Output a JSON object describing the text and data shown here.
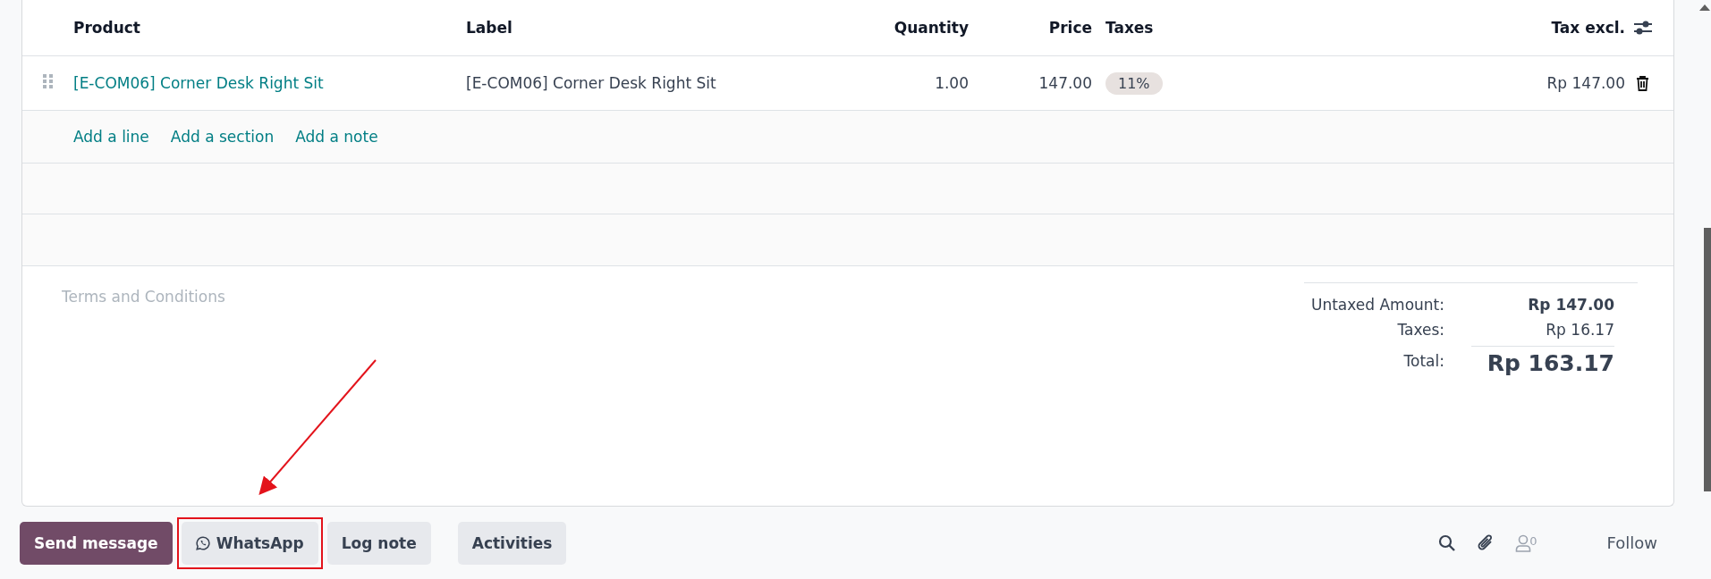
{
  "table": {
    "columns": [
      {
        "label": "Product"
      },
      {
        "label": "Label"
      },
      {
        "label": "Quantity"
      },
      {
        "label": "Price"
      },
      {
        "label": "Taxes"
      },
      {
        "label": "Tax excl."
      }
    ],
    "rows": [
      {
        "product": "[E-COM06] Corner Desk Right Sit",
        "label": "[E-COM06] Corner Desk Right Sit",
        "quantity": "1.00",
        "price": "147.00",
        "taxes": [
          "11%"
        ],
        "subtotal": "Rp 147.00"
      }
    ],
    "add_actions": [
      "Add a line",
      "Add a section",
      "Add a note"
    ]
  },
  "terms": {
    "placeholder": "Terms and Conditions"
  },
  "totals": [
    {
      "label": "Untaxed Amount:",
      "value": "Rp 147.00",
      "kind": "subtotal"
    },
    {
      "label": "Taxes:",
      "value": "Rp 16.17",
      "kind": "tax"
    },
    {
      "label": "Total:",
      "value": "Rp 163.17",
      "kind": "total"
    }
  ],
  "chatter": {
    "buttons": [
      {
        "label": "Send message",
        "kind": "primary",
        "highlighted": false
      },
      {
        "label": "WhatsApp",
        "kind": "whatsapp",
        "highlighted": true
      },
      {
        "label": "Log note",
        "kind": "secondary",
        "highlighted": false
      },
      {
        "label": "Activities",
        "kind": "secondary",
        "highlighted": false
      }
    ],
    "follower_count": "0",
    "follow": "Follow"
  }
}
